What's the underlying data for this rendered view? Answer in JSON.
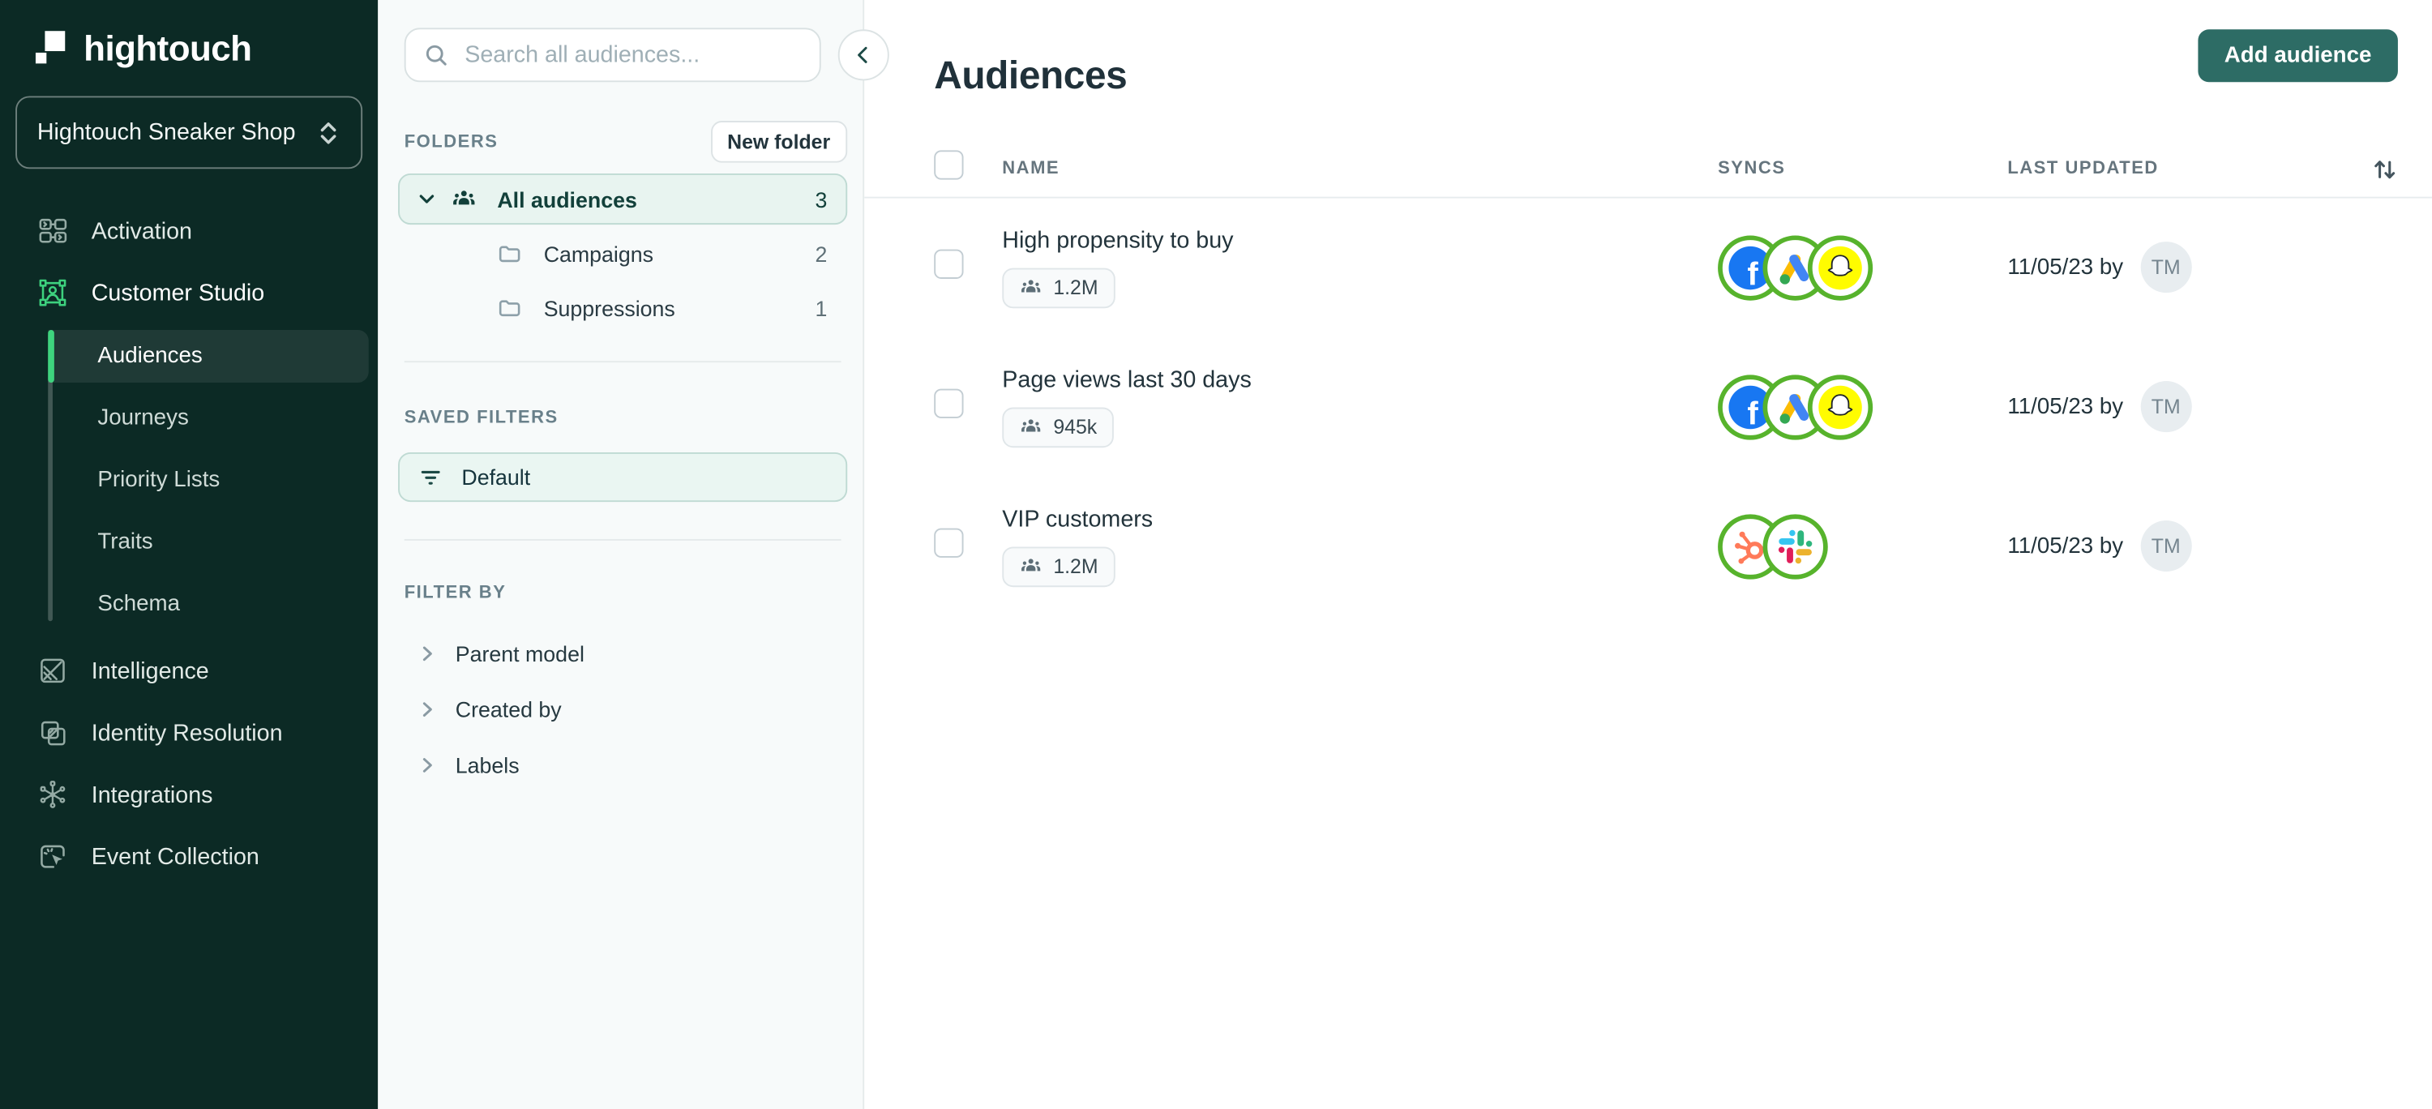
{
  "sidebar": {
    "logo_text": "hightouch",
    "workspace": "Hightouch Sneaker Shop",
    "nav": [
      {
        "label": "Activation"
      },
      {
        "label": "Customer Studio"
      },
      {
        "label": "Intelligence"
      },
      {
        "label": "Identity Resolution"
      },
      {
        "label": "Integrations"
      },
      {
        "label": "Event Collection"
      }
    ],
    "customer_studio_sub": [
      {
        "label": "Audiences",
        "active": true
      },
      {
        "label": "Journeys"
      },
      {
        "label": "Priority Lists"
      },
      {
        "label": "Traits"
      },
      {
        "label": "Schema"
      }
    ]
  },
  "panel": {
    "search_placeholder": "Search all audiences...",
    "folders_label": "FOLDERS",
    "new_folder_label": "New folder",
    "folders": [
      {
        "label": "All audiences",
        "count": "3",
        "selected": true
      },
      {
        "label": "Campaigns",
        "count": "2"
      },
      {
        "label": "Suppressions",
        "count": "1"
      }
    ],
    "saved_filters_label": "SAVED FILTERS",
    "saved_filters": [
      {
        "label": "Default"
      }
    ],
    "filter_by_label": "FILTER BY",
    "filters": [
      {
        "label": "Parent model"
      },
      {
        "label": "Created by"
      },
      {
        "label": "Labels"
      }
    ]
  },
  "main": {
    "title": "Audiences",
    "add_button": "Add audience",
    "columns": {
      "name": "NAME",
      "syncs": "SYNCS",
      "last_updated": "LAST UPDATED"
    },
    "rows": [
      {
        "name": "High propensity to buy",
        "size": "1.2M",
        "syncs": [
          "facebook",
          "google-ads",
          "snapchat"
        ],
        "updated": "11/05/23 by",
        "avatar": "TM"
      },
      {
        "name": "Page views last 30 days",
        "size": "945k",
        "syncs": [
          "facebook",
          "google-ads",
          "snapchat"
        ],
        "updated": "11/05/23 by",
        "avatar": "TM"
      },
      {
        "name": "VIP customers",
        "size": "1.2M",
        "syncs": [
          "hubspot",
          "slack"
        ],
        "updated": "11/05/23 by",
        "avatar": "TM"
      }
    ]
  },
  "colors": {
    "sidebar_bg": "#0C2A25",
    "accent_green": "#3ED47E",
    "button_teal": "#2D6C65",
    "selected_mint": "#E8F4F0",
    "selected_border": "#BFDAD3",
    "sync_ring_green": "#57B32C",
    "facebook_blue": "#1877F2",
    "snapchat_yellow": "#FFFC00",
    "hubspot_orange": "#FF7A59",
    "slack_blue": "#36C5F0",
    "slack_green": "#2EB67D",
    "slack_red": "#E01E5A",
    "slack_yellow": "#ECB22E",
    "avatar_bg": "#E8EDF0"
  }
}
